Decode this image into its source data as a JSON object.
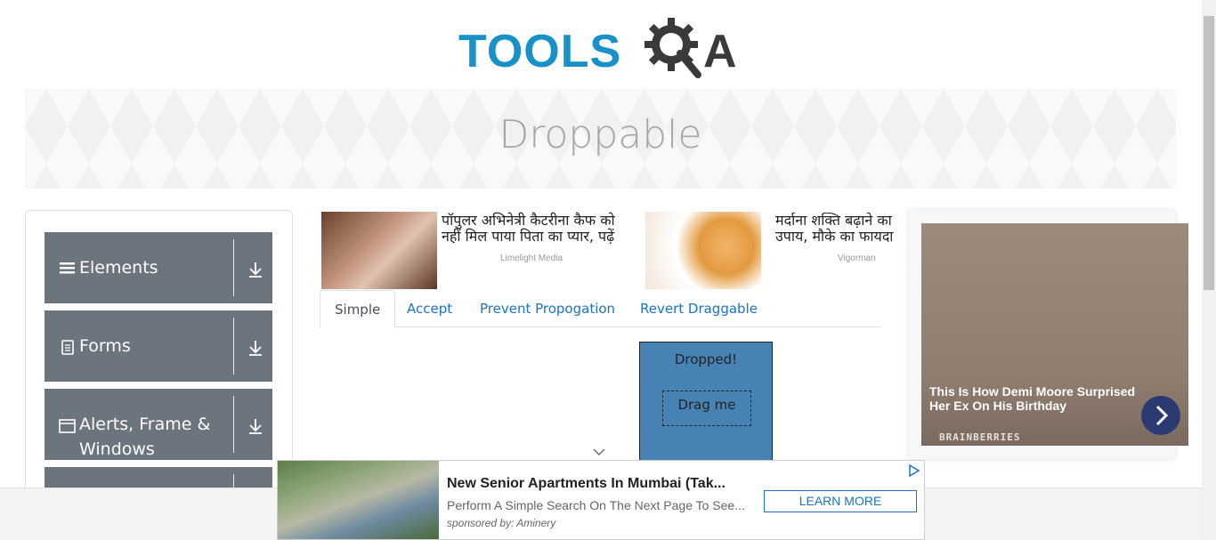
{
  "header": {
    "logo_main": "TOOLS",
    "logo_accent": "A"
  },
  "banner": {
    "title": "Droppable"
  },
  "sidebar": {
    "groups": [
      {
        "label": "Elements",
        "icon": "menu-icon"
      },
      {
        "label": "Forms",
        "icon": "document-icon"
      },
      {
        "label": "Alerts, Frame & Windows",
        "icon": "window-icon"
      }
    ]
  },
  "ads": {
    "item1": {
      "text": "पॉपुलर अभिनेत्री कैटरीना कैफ को नहीं मिल पाया पिता का प्यार, पढ़ें",
      "source": "Limelight Media"
    },
    "item2": {
      "text": "मर्दाना शक्ति बढ़ाने का उपाय, मौके का फायदा",
      "source": "Vigorman"
    }
  },
  "tabs": [
    "Simple",
    "Accept",
    "Prevent Propogation",
    "Revert Draggable"
  ],
  "droppable": {
    "drop_label": "Dropped!",
    "drag_label": "Drag me"
  },
  "right_ad": {
    "title": "This Is How Demi Moore Surprised Her Ex On His Birthday",
    "source": "BRAINBERRIES"
  },
  "bottom_ad": {
    "title": "New Senior Apartments In Mumbai (Tak...",
    "subtitle": "Perform A Simple Search On The Next Page To See...",
    "sponsor": "sponsored by: Aminery",
    "button": "LEARN MORE"
  },
  "colors": {
    "brand_blue": "#1791c8",
    "sidebar_gray": "#6c757d",
    "droppable_fill": "#4682b4",
    "link_blue": "#1a73c8"
  }
}
